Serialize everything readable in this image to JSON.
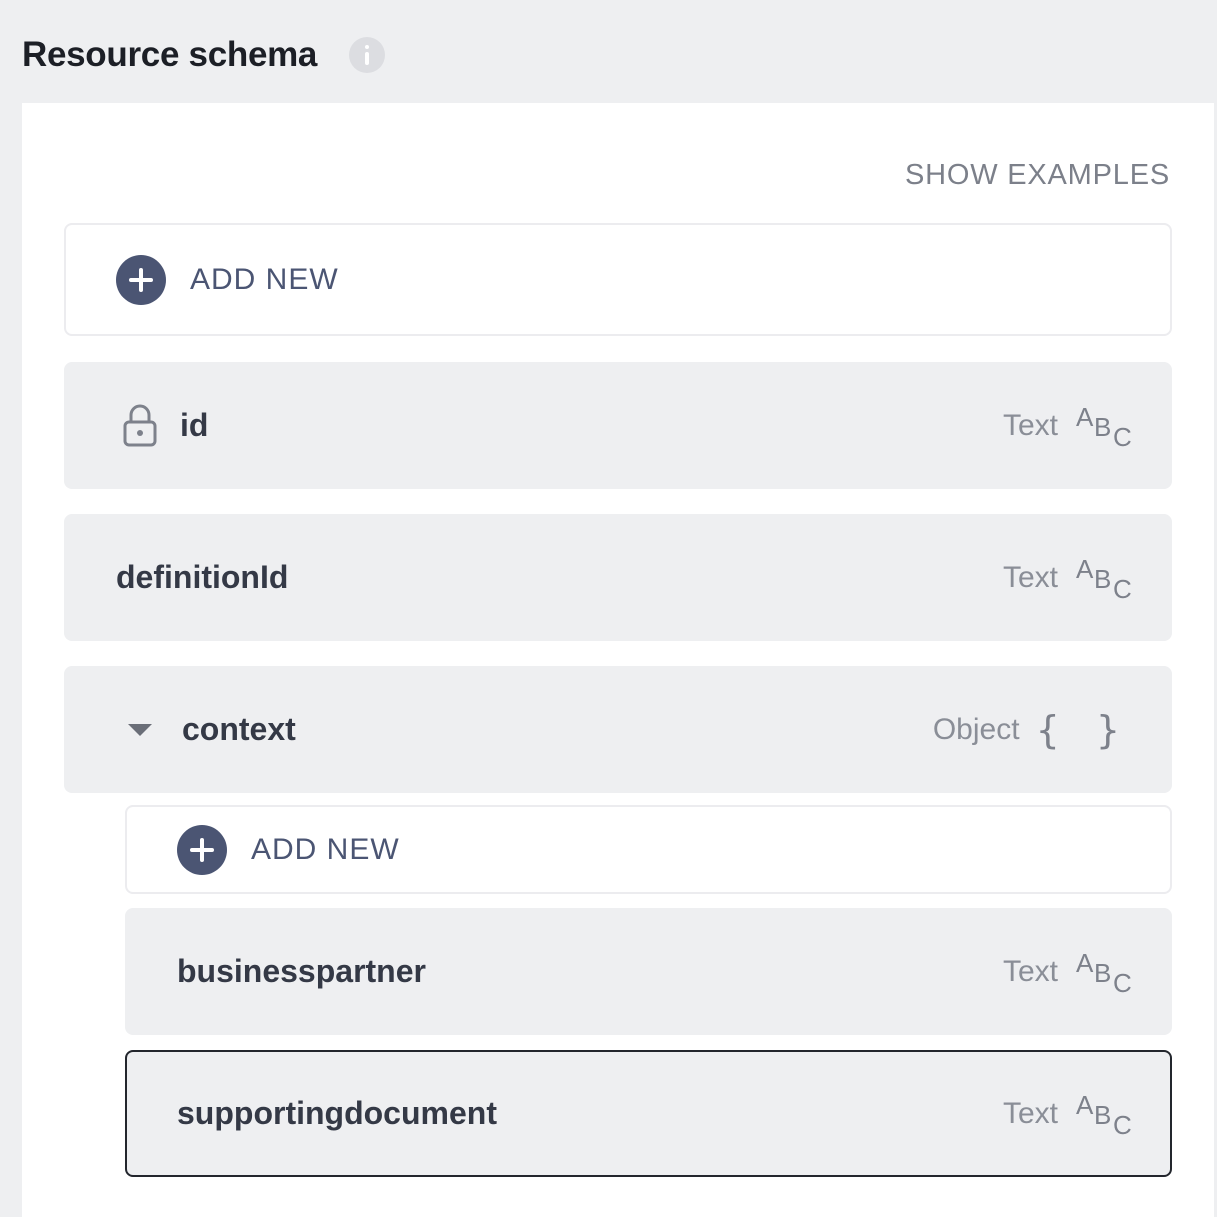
{
  "header": {
    "title": "Resource schema",
    "info_icon": "info-icon"
  },
  "panel": {
    "show_examples_label": "SHOW EXAMPLES",
    "add_new_label": "ADD NEW",
    "fields": [
      {
        "name": "id",
        "type": "Text",
        "type_icon": "abc-icon",
        "locked": true
      },
      {
        "name": "definitionId",
        "type": "Text",
        "type_icon": "abc-icon"
      },
      {
        "name": "context",
        "type": "Object",
        "type_icon": "brace-icon",
        "expanded": true,
        "add_new_label": "ADD NEW",
        "children": [
          {
            "name": "businesspartner",
            "type": "Text",
            "type_icon": "abc-icon"
          },
          {
            "name": "supportingdocument",
            "type": "Text",
            "type_icon": "abc-icon",
            "selected": true
          }
        ]
      }
    ]
  },
  "abc_glyphs": {
    "a": "A",
    "b": "B",
    "c": "C"
  },
  "brace_glyph": "{ }",
  "colors": {
    "background": "#eeeff1",
    "panel": "#ffffff",
    "accent": "#4b5573",
    "row": "#eeeff1",
    "selected_border": "#23262d"
  }
}
